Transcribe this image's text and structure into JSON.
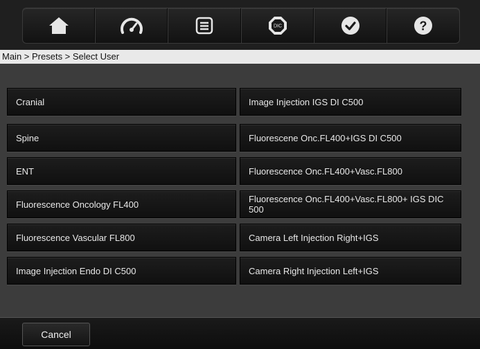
{
  "toolbar": {
    "icons": [
      {
        "name": "home-icon"
      },
      {
        "name": "speedometer-icon"
      },
      {
        "name": "list-icon"
      },
      {
        "name": "dic-icon",
        "label": "DIC"
      },
      {
        "name": "checkmark-icon"
      },
      {
        "name": "help-icon",
        "label": "?"
      }
    ]
  },
  "breadcrumb": "Main > Presets > Select User",
  "presets": {
    "left": [
      "Cranial",
      "Spine",
      "ENT",
      "Fluorescence Oncology FL400",
      "Fluorescence Vascular FL800",
      "Image Injection Endo DI C500"
    ],
    "right": [
      "Image Injection IGS DI C500",
      "Fluorescene Onc.FL400+IGS DI C500",
      "Fluorescence Onc.FL400+Vasc.FL800",
      "Fluorescence Onc.FL400+Vasc.FL800+ IGS DIC 500",
      "Camera Left Injection Right+IGS",
      "Camera Right Injection Left+IGS"
    ]
  },
  "footer": {
    "cancel_label": "Cancel"
  },
  "colors": {
    "background": "#1b1b1b",
    "content": "#3c3c3c",
    "button": "#141414",
    "text": "#e8e8e8",
    "breadcrumb_bg": "#e9e9e9"
  }
}
